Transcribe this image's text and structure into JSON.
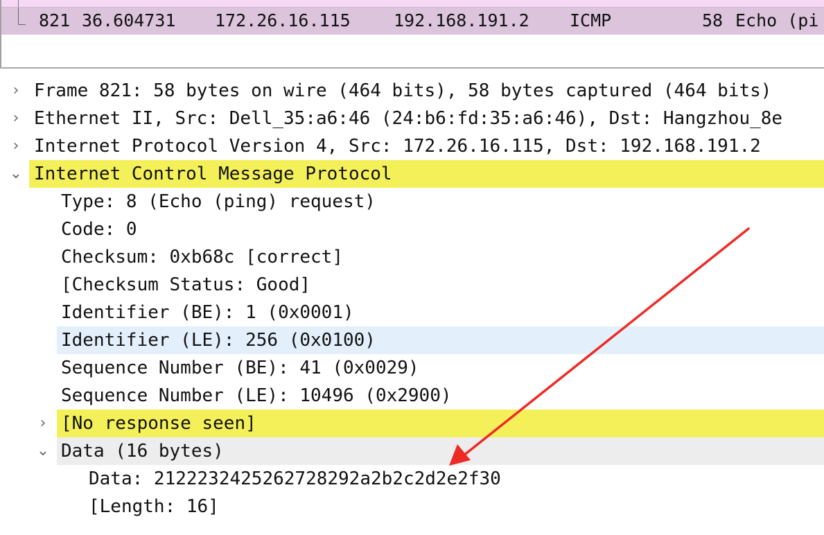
{
  "packet_list": {
    "selected_row": {
      "number": "821",
      "time": "36.604731",
      "source": "172.26.16.115",
      "destination": "192.168.191.2",
      "protocol": "ICMP",
      "length": "58",
      "info": "Echo (pi"
    }
  },
  "details": {
    "frame": "Frame 821: 58 bytes on wire (464 bits), 58 bytes captured (464 bits)",
    "ethernet": "Ethernet II, Src: Dell_35:a6:46 (24:b6:fd:35:a6:46), Dst: Hangzhou_8e",
    "ip": "Internet Protocol Version 4, Src: 172.26.16.115, Dst: 192.168.191.2",
    "icmp": "Internet Control Message Protocol",
    "icmp_fields": {
      "type": "Type: 8 (Echo (ping) request)",
      "code": "Code: 0",
      "checksum": "Checksum: 0xb68c [correct]",
      "checksum_status": "[Checksum Status: Good]",
      "identifier_be": "Identifier (BE): 1 (0x0001)",
      "identifier_le": "Identifier (LE): 256 (0x0100)",
      "sequence_be": "Sequence Number (BE): 41 (0x0029)",
      "sequence_le": "Sequence Number (LE): 10496 (0x2900)",
      "no_response": "[No response seen]",
      "data": "Data (16 bytes)"
    },
    "data_fields": {
      "data": "Data: 2122232425262728292a2b2c2d2e2f30",
      "length": "[Length: 16]"
    }
  },
  "expander_icons": {
    "collapsed": "›",
    "expanded": "⌄"
  },
  "colors": {
    "selected_packet_row": "#dcc4dc",
    "highlight_yellow": "#f4f05a",
    "highlight_blue": "#e3f0fb",
    "annotation_arrow": "#ee2a24"
  }
}
